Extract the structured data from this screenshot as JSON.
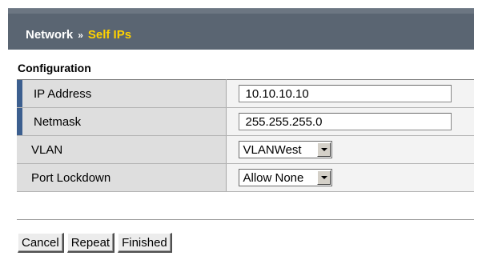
{
  "breadcrumb": {
    "section": "Network",
    "separator": "»",
    "current": "Self IPs"
  },
  "configuration": {
    "title": "Configuration",
    "fields": {
      "ip_address": {
        "label": "IP Address",
        "value": "10.10.10.10",
        "required": true
      },
      "netmask": {
        "label": "Netmask",
        "value": "255.255.255.0",
        "required": true
      },
      "vlan": {
        "label": "VLAN",
        "selected": "VLANWest"
      },
      "port_lockdown": {
        "label": "Port Lockdown",
        "selected": "Allow None"
      }
    }
  },
  "actions": {
    "cancel": "Cancel",
    "repeat": "Repeat",
    "finished": "Finished"
  },
  "colors": {
    "header_bg": "#5a6572",
    "breadcrumb_current": "#ffd200",
    "required_marker": "#3c5f8f",
    "label_bg": "#dedede"
  },
  "icons": {
    "select_arrow": "chevron-down-icon"
  }
}
